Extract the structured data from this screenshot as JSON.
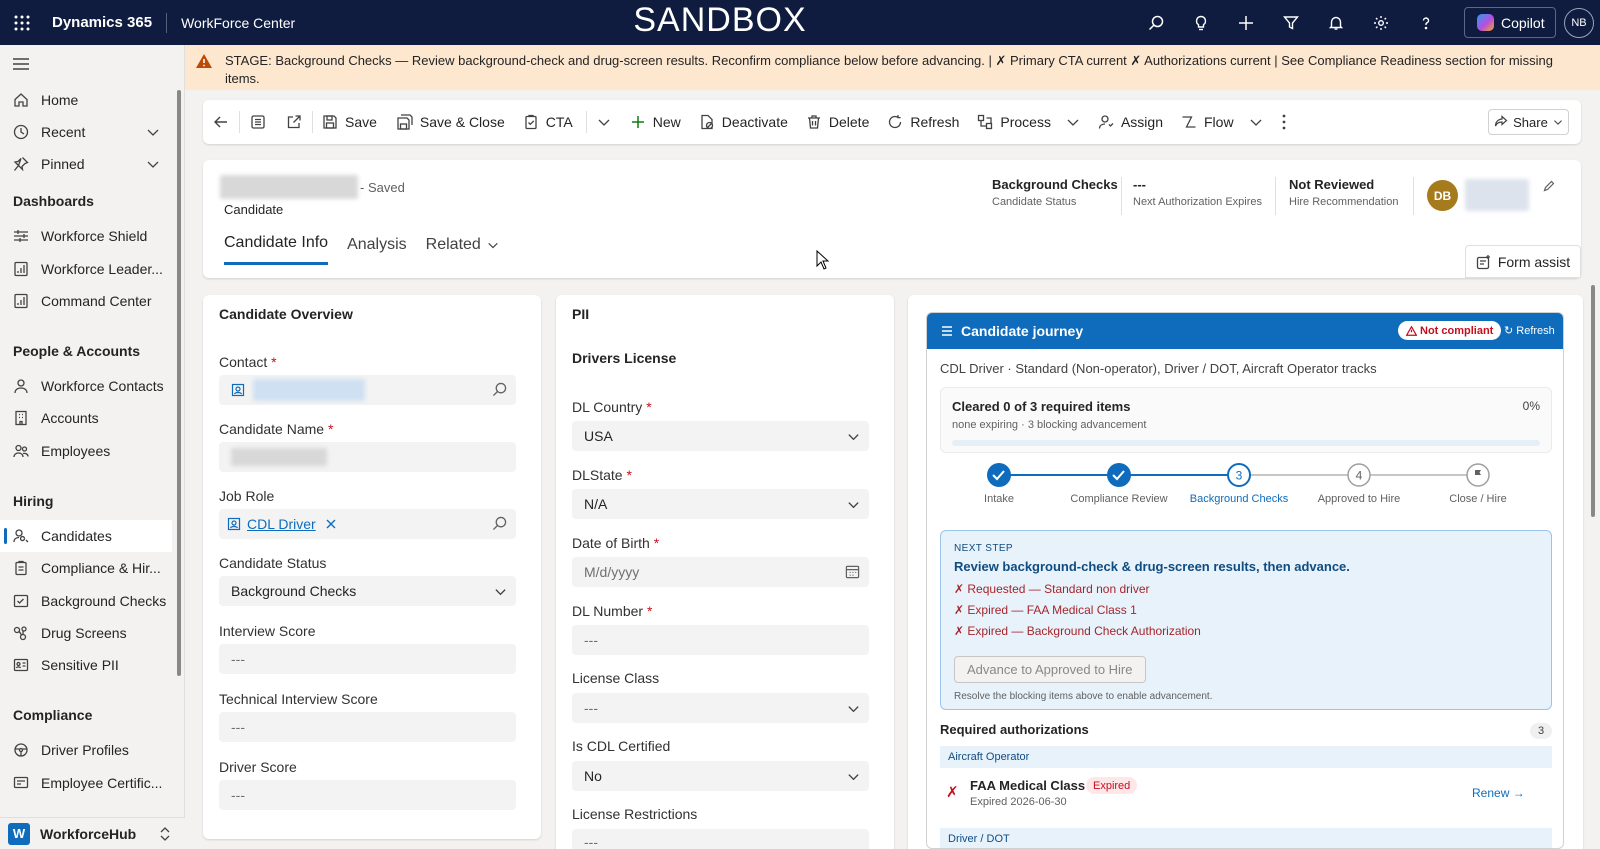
{
  "topbar": {
    "brand": "Dynamics 365",
    "app": "WorkForce Center",
    "environment": "SANDBOX",
    "copilot": "Copilot",
    "user_initials": "NB",
    "icons": [
      "search-icon",
      "lightbulb-icon",
      "plus-icon",
      "filter-icon",
      "bell-icon",
      "gear-icon",
      "help-icon"
    ]
  },
  "sidebar": {
    "top": [
      {
        "label": "Home",
        "icon": "home-icon"
      },
      {
        "label": "Recent",
        "icon": "clock-icon",
        "chevron": true
      },
      {
        "label": "Pinned",
        "icon": "pin-icon",
        "chevron": true
      }
    ],
    "groups": [
      {
        "title": "Dashboards",
        "items": [
          "Workforce Shield",
          "Workforce Leader...",
          "Command Center"
        ]
      },
      {
        "title": "People & Accounts",
        "items": [
          "Workforce Contacts",
          "Accounts",
          "Employees"
        ]
      },
      {
        "title": "Hiring",
        "items": [
          "Candidates",
          "Compliance & Hir...",
          "Background Checks",
          "Drug Screens",
          "Sensitive PII"
        ]
      },
      {
        "title": "Compliance",
        "items": [
          "Driver Profiles",
          "Employee Certific..."
        ]
      }
    ],
    "active_item": "Candidates",
    "footer": {
      "badge": "W",
      "label": "WorkforceHub"
    }
  },
  "banner": {
    "text": "STAGE: Background Checks — Review background-check and drug-screen results. Reconfirm compliance below before advancing. | ✗ Primary CTA current ✗ Authorizations current | See Compliance Readiness section for missing items."
  },
  "commandbar": {
    "save": "Save",
    "save_close": "Save & Close",
    "cta": "CTA",
    "new": "New",
    "deactivate": "Deactivate",
    "delete": "Delete",
    "refresh": "Refresh",
    "process": "Process",
    "assign": "Assign",
    "flow": "Flow",
    "share": "Share"
  },
  "header": {
    "saved_status": "- Saved",
    "entity": "Candidate",
    "tabs": [
      "Candidate Info",
      "Analysis",
      "Related"
    ],
    "fields": [
      {
        "value": "Background Checks",
        "label": "Candidate Status"
      },
      {
        "value": "---",
        "label": "Next Authorization Expires"
      },
      {
        "value": "Not Reviewed",
        "label": "Hire Recommendation"
      }
    ],
    "owner_initials": "DB",
    "form_assist": "Form assist"
  },
  "overview": {
    "title": "Candidate Overview",
    "contact_label": "Contact",
    "candidate_name_label": "Candidate Name",
    "job_role_label": "Job Role",
    "job_role_value": "CDL Driver",
    "status_label": "Candidate Status",
    "status_value": "Background Checks",
    "interview_label": "Interview Score",
    "interview_value": "---",
    "tech_label": "Technical Interview Score",
    "tech_value": "---",
    "driver_label": "Driver Score",
    "driver_value": "---"
  },
  "pii": {
    "title": "PII",
    "section": "Drivers License",
    "dl_country_label": "DL Country",
    "dl_country_value": "USA",
    "dl_state_label": "DLState",
    "dl_state_value": "N/A",
    "dob_label": "Date of Birth",
    "dob_placeholder": "M/d/yyyy",
    "dl_number_label": "DL Number",
    "dl_number_value": "---",
    "license_class_label": "License Class",
    "license_class_value": "---",
    "cdl_label": "Is CDL Certified",
    "cdl_value": "No",
    "restrictions_label": "License Restrictions",
    "restrictions_value": "---"
  },
  "journey": {
    "title": "Candidate journey",
    "badge": "Not compliant",
    "refresh": "Refresh",
    "tracks": "CDL Driver · Standard (Non-operator), Driver / DOT, Aircraft Operator tracks",
    "cleared": "Cleared 0 of 3 required items",
    "cleared_sub": "none expiring · 3 blocking advancement",
    "percent": "0%",
    "progress": 0,
    "steps": [
      {
        "label": "Intake",
        "state": "done"
      },
      {
        "label": "Compliance Review",
        "state": "done"
      },
      {
        "label": "Background Checks",
        "state": "current",
        "num": "3"
      },
      {
        "label": "Approved to Hire",
        "state": "todo",
        "num": "4"
      },
      {
        "label": "Close / Hire",
        "state": "flag"
      }
    ],
    "next_step_label": "NEXT STEP",
    "next_step": "Review background-check & drug-screen results, then advance.",
    "blockers": [
      "✗ Requested — Standard non driver",
      "✗ Expired — FAA Medical Class 1",
      "✗ Expired — Background Check Authorization"
    ],
    "advance_button": "Advance to Approved to Hire",
    "advance_hint": "Resolve the blocking items above to enable advancement.",
    "auth_title": "Required authorizations",
    "auth_count": "3",
    "groups": [
      {
        "name": "Aircraft Operator",
        "items": [
          {
            "mark": "✗",
            "name": "FAA Medical Class 1",
            "badge": "Expired",
            "sub": "Expired 2026-06-30",
            "action": "Renew →"
          }
        ]
      },
      {
        "name": "Driver / DOT",
        "items": []
      }
    ]
  },
  "colors": {
    "nav": "#0f1c3f",
    "accent": "#0f6cbd",
    "banner": "#fde7cf",
    "error": "#c50f1f"
  }
}
